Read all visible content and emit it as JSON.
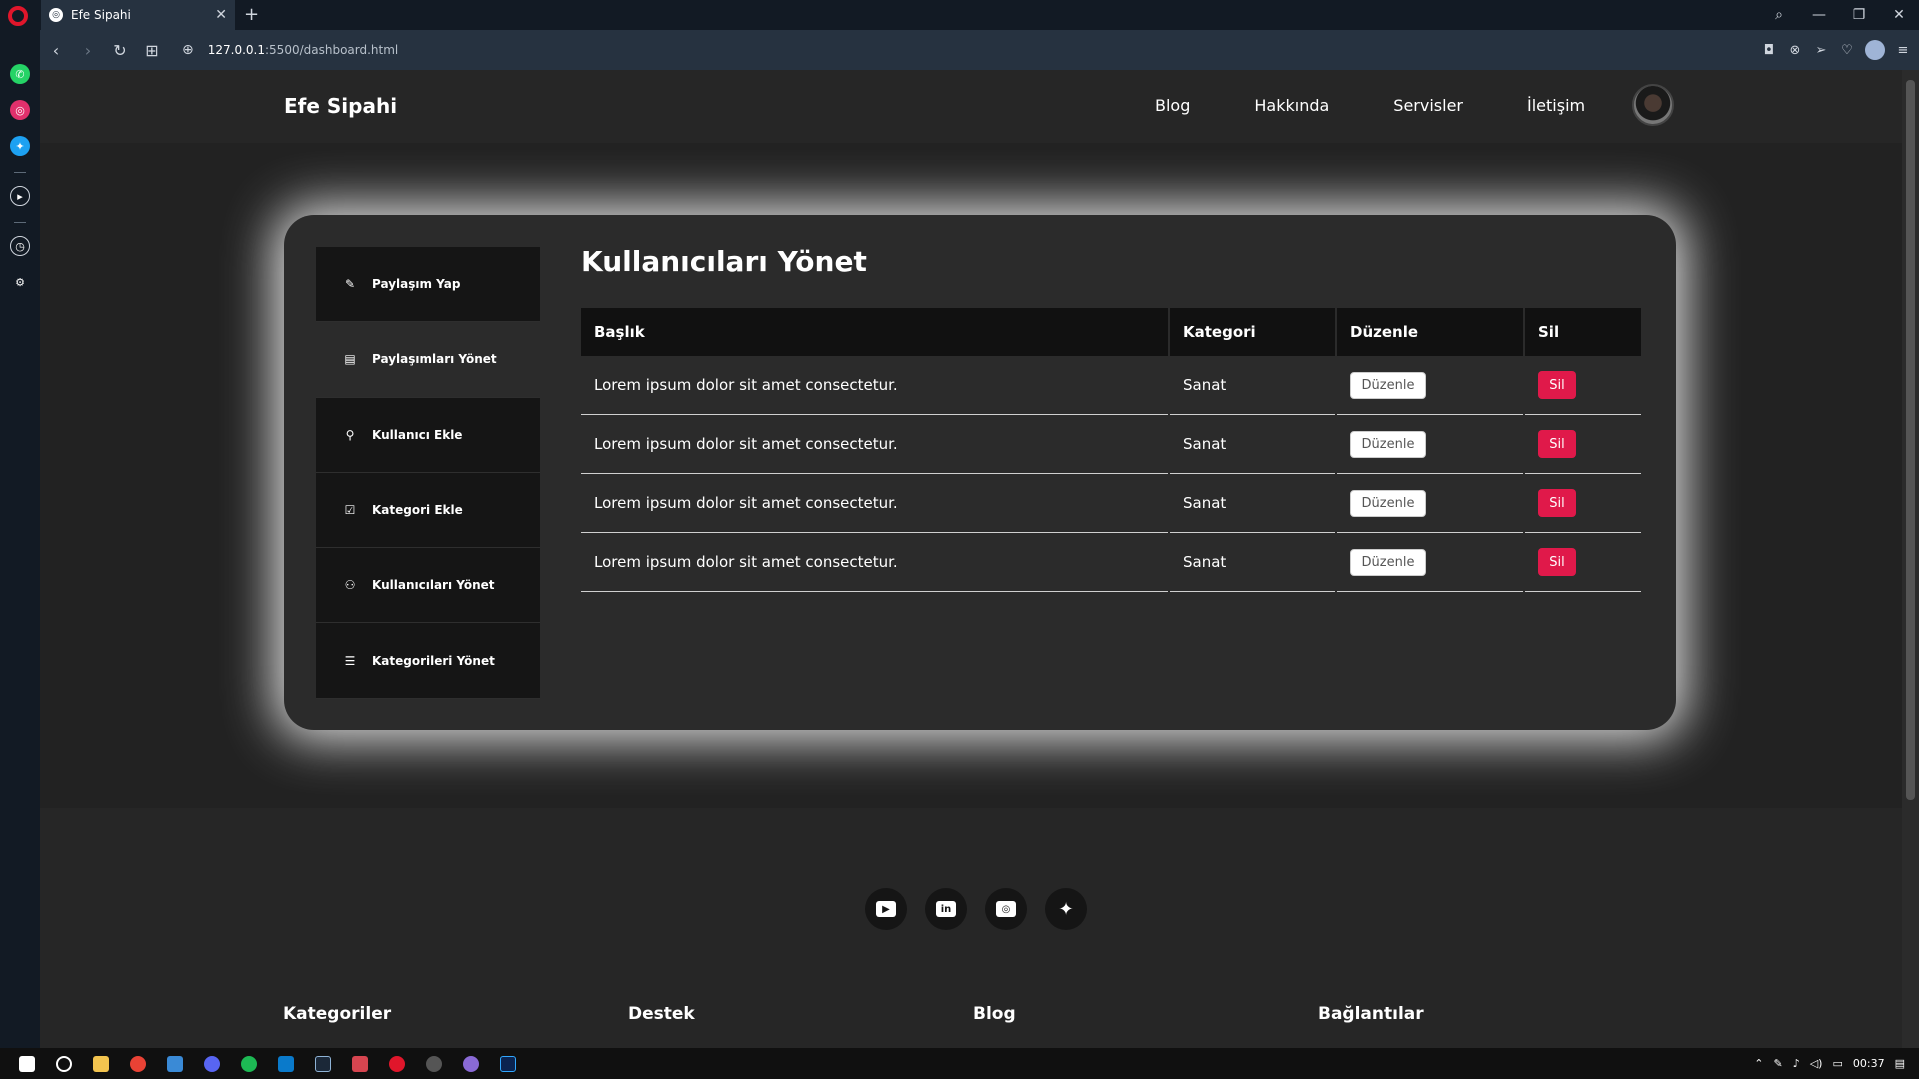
{
  "browser": {
    "tab_title": "Efe Sipahi",
    "tab_close": "✕",
    "new_tab": "+",
    "url_host": "127.0.0.1",
    "url_path": ":5500/dashboard.html",
    "window_controls": [
      "⌕",
      "—",
      "❐",
      "✕"
    ],
    "nav": [
      "‹",
      "›",
      "↻",
      "⊞"
    ],
    "addr_icons": [
      "camera-icon",
      "shield-icon",
      "send-icon",
      "heart-icon",
      "profile-icon",
      "menu-icon"
    ]
  },
  "side_icons": [
    {
      "name": "whatsapp-icon",
      "color": "#25d366"
    },
    {
      "name": "instagram-icon",
      "color": "#e1306c"
    },
    {
      "name": "twitter-icon",
      "color": "#1da1f2"
    },
    {
      "name": "player-icon",
      "color": "#121a24"
    },
    {
      "name": "history-icon",
      "color": "#121a24"
    },
    {
      "name": "settings-icon",
      "color": "#121a24"
    }
  ],
  "site": {
    "brand": "Efe Sipahi",
    "menu": [
      "Blog",
      "Hakkında",
      "Servisler",
      "İletişim"
    ]
  },
  "dashboard": {
    "menu": [
      {
        "label": "Paylaşım Yap",
        "icon": "✎"
      },
      {
        "label": "Paylaşımları Yönet",
        "icon": "▤"
      },
      {
        "label": "Kullanıcı Ekle",
        "icon": "⚲"
      },
      {
        "label": "Kategori Ekle",
        "icon": "☑"
      },
      {
        "label": "Kullanıcıları Yönet",
        "icon": "⚇"
      },
      {
        "label": "Kategorileri Yönet",
        "icon": "☰"
      }
    ],
    "title": "Kullanıcıları Yönet",
    "columns": [
      "Başlık",
      "Kategori",
      "Düzenle",
      "Sil"
    ],
    "rows": [
      {
        "title": "Lorem ipsum dolor sit amet consectetur.",
        "category": "Sanat",
        "edit": "Düzenle",
        "delete": "Sil"
      },
      {
        "title": "Lorem ipsum dolor sit amet consectetur.",
        "category": "Sanat",
        "edit": "Düzenle",
        "delete": "Sil"
      },
      {
        "title": "Lorem ipsum dolor sit amet consectetur.",
        "category": "Sanat",
        "edit": "Düzenle",
        "delete": "Sil"
      },
      {
        "title": "Lorem ipsum dolor sit amet consectetur.",
        "category": "Sanat",
        "edit": "Düzenle",
        "delete": "Sil"
      }
    ],
    "accent_delete": "#e0194a"
  },
  "footer": {
    "socials": [
      "youtube-icon",
      "linkedin-icon",
      "instagram-icon",
      "twitter-icon"
    ],
    "columns": [
      "Kategoriler",
      "Destek",
      "Blog",
      "Bağlantılar"
    ]
  },
  "taskbar": {
    "time": "00:37"
  }
}
